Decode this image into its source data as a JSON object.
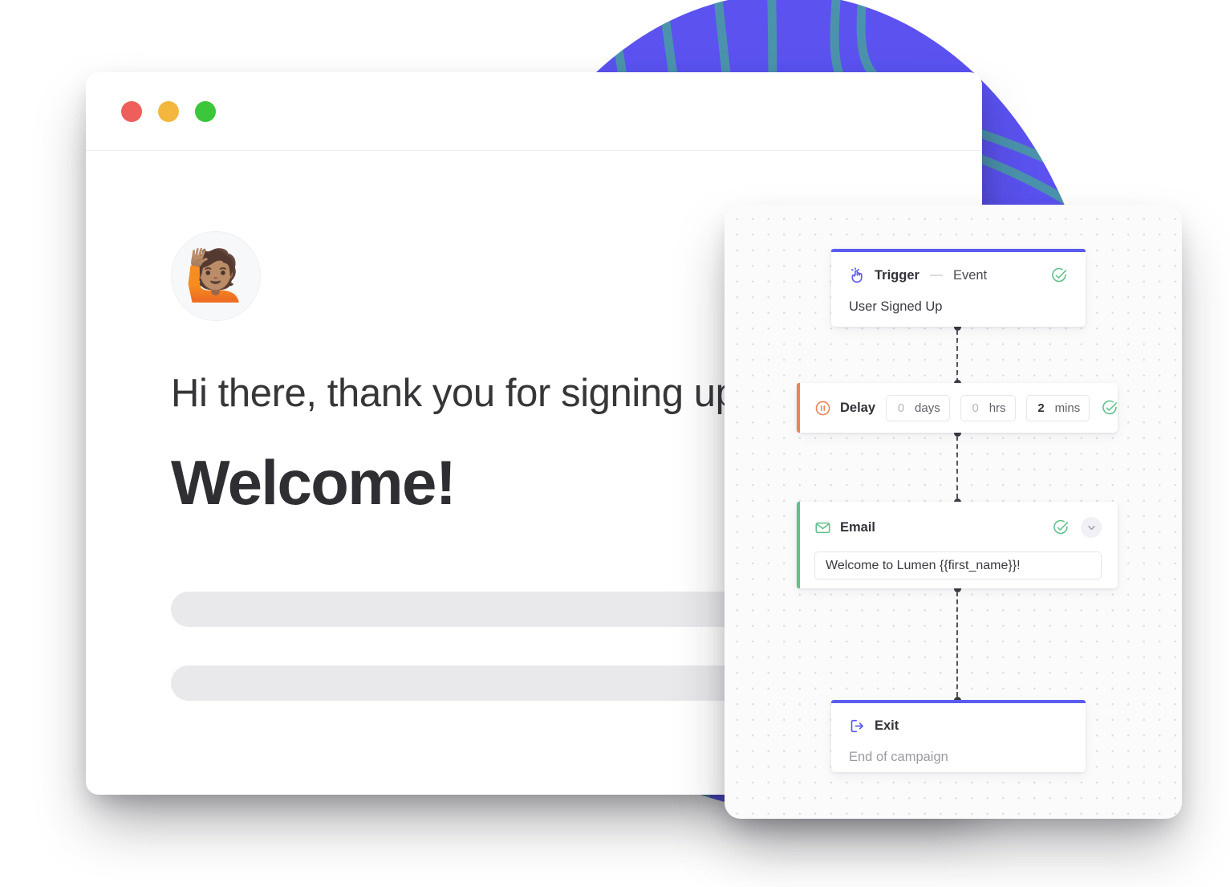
{
  "browser": {
    "traffic_lights": [
      {
        "name": "close",
        "color": "#ee5e5b"
      },
      {
        "name": "minimize",
        "color": "#f4b73e"
      },
      {
        "name": "maximize",
        "color": "#3bc63b"
      }
    ],
    "avatar_emoji": "🙋🏽",
    "greeting": "Hi there, thank you for signing up",
    "headline": "Welcome!"
  },
  "flow": {
    "trigger": {
      "icon": "tap-hand-icon",
      "title": "Trigger",
      "subtitle": "Event",
      "value": "User Signed Up",
      "status": "complete",
      "accent": "#5b5bef"
    },
    "delay": {
      "icon": "pause-circle-icon",
      "title": "Delay",
      "fields": [
        {
          "value": "0",
          "unit": "days",
          "filled": false
        },
        {
          "value": "0",
          "unit": "hrs",
          "filled": false
        },
        {
          "value": "2",
          "unit": "mins",
          "filled": true
        }
      ],
      "status": "complete",
      "accent": "#f08055"
    },
    "email": {
      "icon": "envelope-icon",
      "title": "Email",
      "subject": "Welcome to Lumen {{first_name}}!",
      "status": "complete",
      "accent": "#5ec08a"
    },
    "exit": {
      "icon": "exit-arrow-icon",
      "title": "Exit",
      "value": "End of campaign",
      "accent": "#5b5bef"
    }
  },
  "colors": {
    "purple": "#5b5bef",
    "green": "#5ec08a",
    "orange": "#f08055",
    "blob_purple": "#5b52f0",
    "blob_teal": "#4a9aa8"
  }
}
